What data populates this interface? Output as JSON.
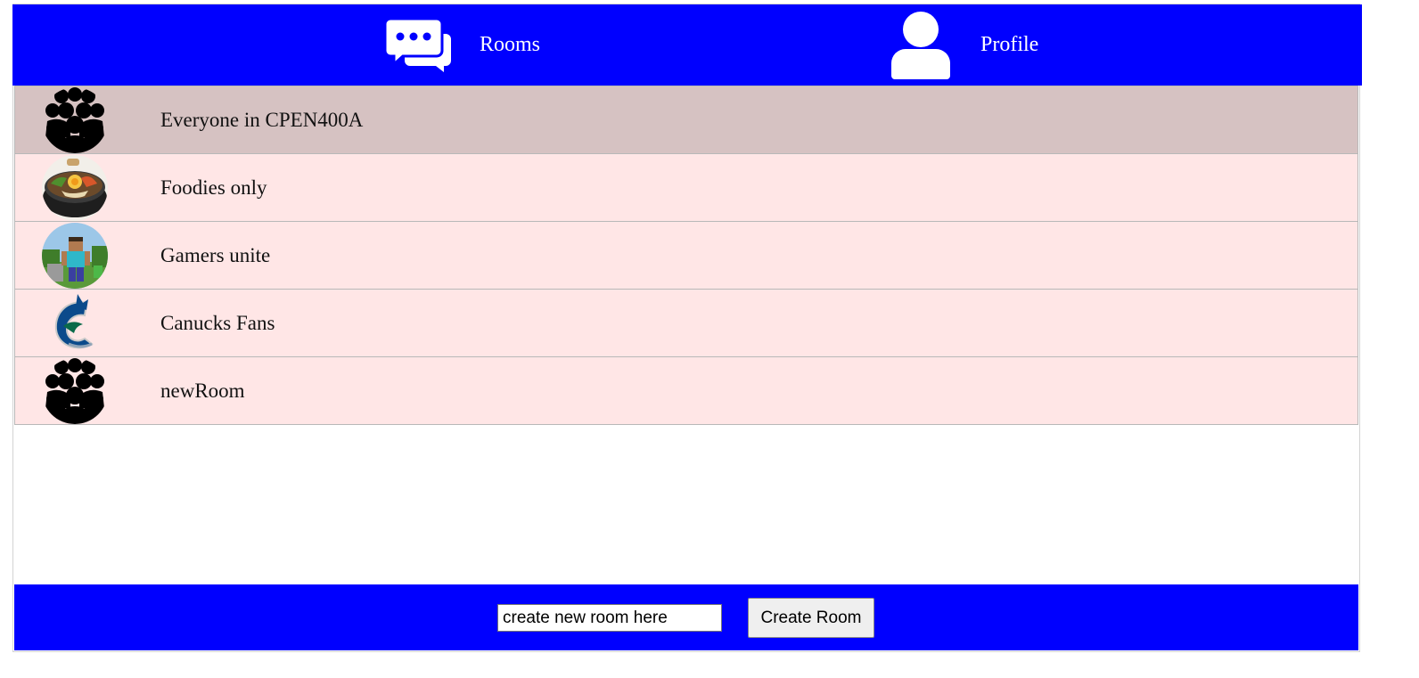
{
  "nav": {
    "rooms_label": "Rooms",
    "profile_label": "Profile",
    "rooms_icon": "chat-bubbles-icon",
    "profile_icon": "user-icon"
  },
  "rooms": [
    {
      "name": "Everyone in CPEN400A",
      "icon": "group-icon",
      "active": true
    },
    {
      "name": "Foodies only",
      "icon": "food-bowl-image",
      "active": false
    },
    {
      "name": "Gamers unite",
      "icon": "minecraft-image",
      "active": false
    },
    {
      "name": "Canucks Fans",
      "icon": "canucks-logo",
      "active": false
    },
    {
      "name": "newRoom",
      "icon": "group-icon",
      "active": false
    }
  ],
  "create": {
    "input_value": "create new room here",
    "button_label": "Create Room"
  },
  "colors": {
    "bar": "#0000ff",
    "room_bg": "#ffe6e6",
    "room_active_bg": "#d6c2c2"
  }
}
